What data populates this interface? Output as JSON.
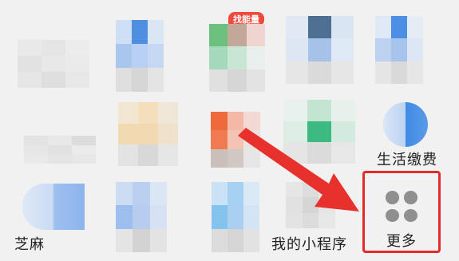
{
  "grid": {
    "row1": [
      {
        "label": "",
        "badge": ""
      },
      {
        "label": "",
        "badge": ""
      },
      {
        "label": "",
        "badge": "找能量"
      },
      {
        "label": "",
        "badge": ""
      },
      {
        "label": "",
        "badge": ""
      }
    ],
    "row2": [
      {
        "label": ""
      },
      {
        "label": ""
      },
      {
        "label": ""
      },
      {
        "label": ""
      },
      {
        "label": "生活缴费"
      }
    ],
    "row3": [
      {
        "label": "芝麻"
      },
      {
        "label": ""
      },
      {
        "label": ""
      },
      {
        "label": "我的小程序"
      }
    ]
  },
  "more": {
    "label": "更多"
  },
  "colors": {
    "highlight_border": "#e32b2b",
    "arrow": "#e8312c"
  }
}
